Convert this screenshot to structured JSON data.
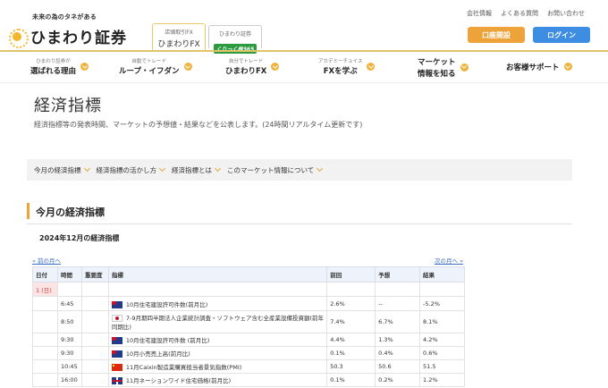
{
  "header": {
    "tagline": "未来の為のタネがある",
    "logo_name": "ひまわり証券",
    "tabs": [
      {
        "small": "店頭取引FX",
        "big": "ひまわりFX"
      },
      {
        "small": "ひまわり証券",
        "badge": "くりっく株365"
      }
    ],
    "util_links": [
      "会社情報",
      "よくある質問",
      "お問い合わせ"
    ],
    "open_account": "口座開設",
    "login": "ログイン"
  },
  "nav": [
    {
      "small": "ひまわり証券が",
      "big": "選ばれる理由"
    },
    {
      "small": "自動でトレード",
      "big": "ループ・イフダン"
    },
    {
      "small": "自分でトレード",
      "big": "ひまわりFX"
    },
    {
      "small": "アカデミーチョイス",
      "big": "FXを学ぶ"
    },
    {
      "small": "マーケット",
      "big": "情報を知る"
    },
    {
      "small": "",
      "big": "お客様サポート"
    }
  ],
  "page": {
    "title": "経済指標",
    "description": "経済指標等の発表時間、マーケットの予想値・結果などを公表します。(24時間リアルタイム更新です)"
  },
  "subnav": [
    "今月の経済指標",
    "経済指標の活かし方",
    "経済指標とは",
    "このマーケット情報について"
  ],
  "section": {
    "title": "今月の経済指標",
    "month_title": "2024年12月の経済指標",
    "prev": "« 前の月へ",
    "next": "次の月へ »"
  },
  "table": {
    "headers": [
      "日付",
      "時間",
      "重要度",
      "指標",
      "前回",
      "予想",
      "結果"
    ],
    "day": "1 (日)",
    "rows": [
      {
        "time": "6:45",
        "flag": "au",
        "indicator": "10月住宅建設許可件数(前月比)",
        "prev": "2.6%",
        "forecast": "--",
        "result": "-5.2%"
      },
      {
        "time": "8:50",
        "flag": "jp",
        "indicator": "7-9月期四半期法人企業統計調査・ソフトウェア含む全産業設備投資額(前年同期比)",
        "prev": "7.4%",
        "forecast": "6.7%",
        "result": "8.1%"
      },
      {
        "time": "9:30",
        "flag": "au",
        "indicator": "10月住宅建設許可件数 (前月比)",
        "prev": "4.4%",
        "forecast": "1.3%",
        "result": "4.2%"
      },
      {
        "time": "9:30",
        "flag": "au",
        "indicator": "10月小売売上高(前月比)",
        "prev": "0.1%",
        "forecast": "0.4%",
        "result": "0.6%"
      },
      {
        "time": "10:45",
        "flag": "cn",
        "indicator": "11月Caixin製造業購買担当者景気指数(PMI)",
        "prev": "50.3",
        "forecast": "50.6",
        "result": "51.5"
      },
      {
        "time": "16:00",
        "flag": "uk",
        "indicator": "11月ネーションワイド住宅価格(前月比)",
        "prev": "0.1%",
        "forecast": "0.2%",
        "result": "1.2%"
      }
    ]
  },
  "colors": {
    "accent": "#eea23a",
    "login": "#3d8ee2",
    "gold_line": "#e2c46a"
  }
}
